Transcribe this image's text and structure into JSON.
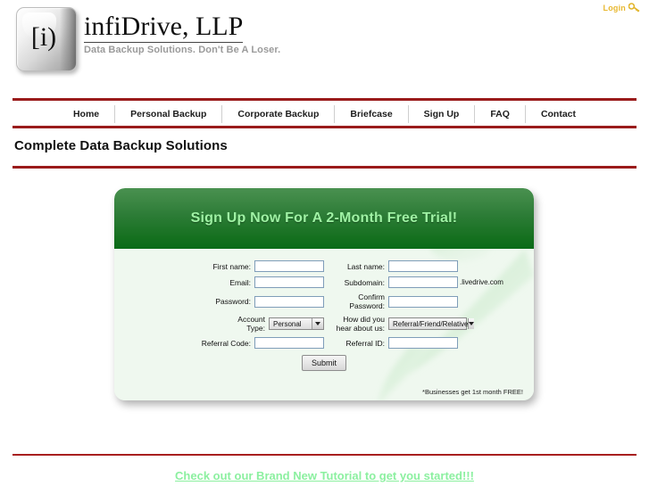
{
  "topbar": {
    "login_label": "Login",
    "key_icon": "key-icon"
  },
  "logo": {
    "keycap_glyph": "[i)",
    "brand_name": "infiDrive, LLP",
    "tagline": "Data Backup Solutions. Don't Be A Loser."
  },
  "nav": {
    "items": [
      {
        "label": "Home"
      },
      {
        "label": "Personal Backup"
      },
      {
        "label": "Corporate Backup"
      },
      {
        "label": "Briefcase"
      },
      {
        "label": "Sign Up"
      },
      {
        "label": "FAQ"
      },
      {
        "label": "Contact"
      }
    ]
  },
  "main": {
    "page_title": "Complete Data Backup Solutions"
  },
  "signup_card": {
    "header_title": "Sign Up Now For A 2-Month Free Trial!",
    "fields": {
      "first_name": {
        "label": "First name:",
        "value": "",
        "placeholder": ""
      },
      "last_name": {
        "label": "Last name:",
        "value": "",
        "placeholder": ""
      },
      "email": {
        "label": "Email:",
        "value": "",
        "placeholder": ""
      },
      "subdomain": {
        "label": "Subdomain:",
        "value": "",
        "placeholder": "",
        "suffix": ".livedrive.com"
      },
      "password": {
        "label": "Password:",
        "value": "",
        "placeholder": ""
      },
      "confirm_password": {
        "label": "Confirm Password:",
        "value": "",
        "placeholder": ""
      },
      "account_type": {
        "label": "Account\nType:",
        "selected": "Personal"
      },
      "hear_about_us": {
        "label": "How did you\nhear about us:",
        "selected": "Referral/Friend/Relative"
      },
      "referral_code": {
        "label": "Referral Code:",
        "value": "",
        "placeholder": ""
      },
      "referral_id": {
        "label": "Referral ID:",
        "value": "",
        "placeholder": ""
      }
    },
    "submit_label": "Submit",
    "fineprint": "*Businesses get 1st month FREE!"
  },
  "footer": {
    "tutorial_link": "Check out our Brand New Tutorial to get you started!!!"
  },
  "colors": {
    "rule_red": "#9a1b1b",
    "header_green_top": "#4a9150",
    "header_green_bottom": "#0a6b18",
    "card_body_green": "#eff8ef",
    "header_text_green": "#9ff2a4",
    "login_gold": "#e8b830",
    "footer_link_green": "#8cf0a0"
  }
}
